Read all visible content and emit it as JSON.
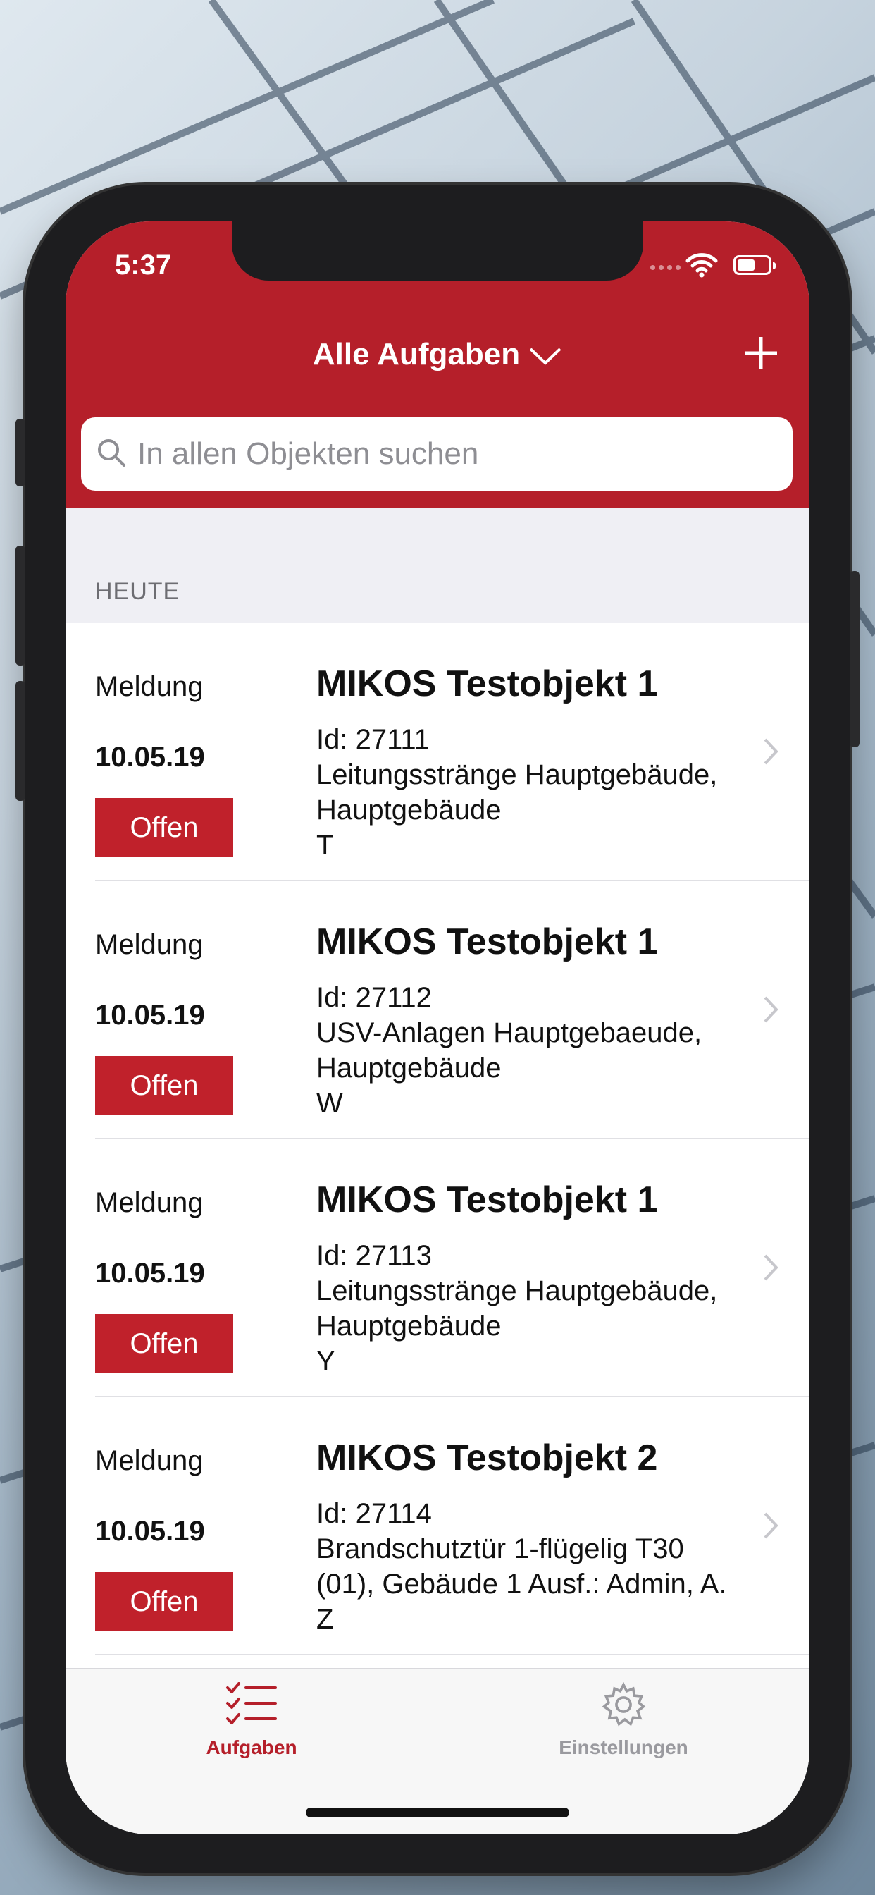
{
  "status_bar": {
    "time": "5:37"
  },
  "header": {
    "title": "Alle Aufgaben",
    "add_icon": "plus-icon",
    "title_icon": "chevron-down-icon"
  },
  "search": {
    "placeholder": "In allen Objekten suchen",
    "value": "",
    "icon": "search-icon"
  },
  "section": {
    "label": "HEUTE"
  },
  "tasks": [
    {
      "type": "Meldung",
      "date": "10.05.19",
      "status": "Offen",
      "object": "MIKOS Testobjekt 1",
      "lines": [
        "Id: 27111",
        "Leitungsstränge Hauptgebäude,",
        "Hauptgebäude",
        "T"
      ]
    },
    {
      "type": "Meldung",
      "date": "10.05.19",
      "status": "Offen",
      "object": "MIKOS Testobjekt 1",
      "lines": [
        "Id: 27112",
        "USV-Anlagen Hauptgebaeude,",
        "Hauptgebäude",
        "W"
      ]
    },
    {
      "type": "Meldung",
      "date": "10.05.19",
      "status": "Offen",
      "object": "MIKOS Testobjekt 1",
      "lines": [
        "Id: 27113",
        "Leitungsstränge Hauptgebäude,",
        "Hauptgebäude",
        "Y"
      ]
    },
    {
      "type": "Meldung",
      "date": "10.05.19",
      "status": "Offen",
      "object": "MIKOS Testobjekt 2",
      "lines": [
        "Id: 27114",
        "Brandschutztür 1-flügelig T30",
        "(01), Gebäude 1 Ausf.: Admin, A.",
        "Z"
      ]
    }
  ],
  "tabbar": {
    "tabs": [
      {
        "label": "Aufgaben",
        "icon": "checklist-icon",
        "active": true
      },
      {
        "label": "Einstellungen",
        "icon": "gear-icon",
        "active": false
      }
    ]
  },
  "colors": {
    "accent": "#b51f2a",
    "status_badge": "#c0212b",
    "section_bg": "#efeff4"
  }
}
